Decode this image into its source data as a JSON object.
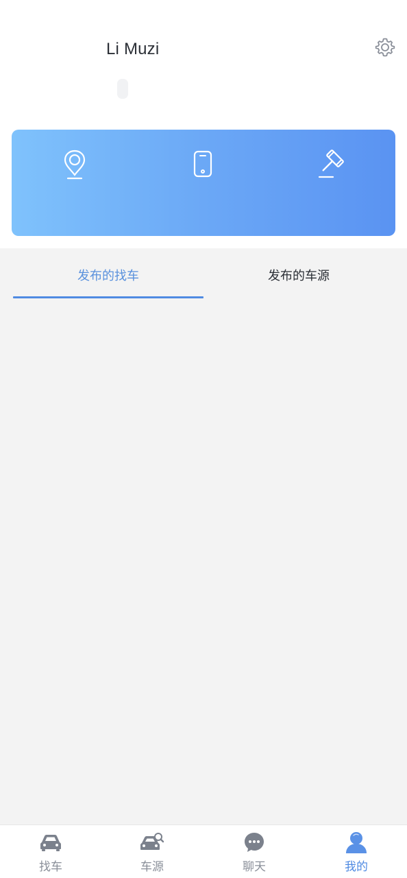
{
  "profile": {
    "name": "Li Muzi"
  },
  "settings": {
    "icon": "gear-icon"
  },
  "card": {
    "items": [
      {
        "icon": "location-pin-icon"
      },
      {
        "icon": "phone-icon"
      },
      {
        "icon": "auction-hammer-icon"
      }
    ]
  },
  "tabs": [
    {
      "label": "发布的找车",
      "active": true
    },
    {
      "label": "发布的车源",
      "active": false
    }
  ],
  "bottom_nav": [
    {
      "label": "找车",
      "icon": "car-icon",
      "active": false
    },
    {
      "label": "车源",
      "icon": "car-search-icon",
      "active": false
    },
    {
      "label": "聊天",
      "icon": "chat-bubble-icon",
      "active": false
    },
    {
      "label": "我的",
      "icon": "user-icon",
      "active": true
    }
  ],
  "colors": {
    "accent": "#4f8ae2",
    "card_gradient_start": "#7fc2fc",
    "card_gradient_end": "#5a93f2",
    "inactive_nav": "#8a8f99"
  }
}
